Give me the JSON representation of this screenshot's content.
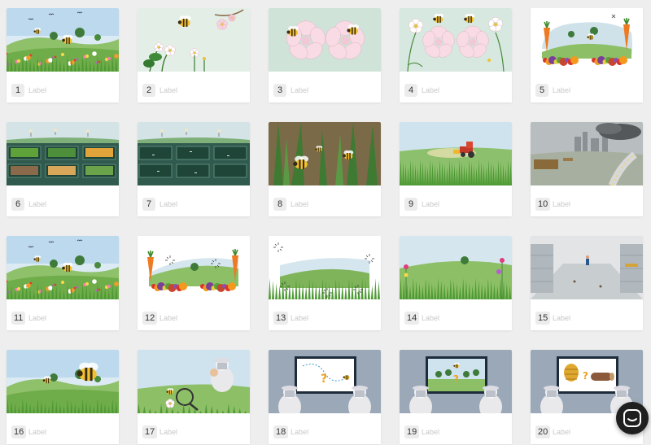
{
  "cards": [
    {
      "number": "1",
      "label": "Label",
      "scene": "meadow-flowers-bees"
    },
    {
      "number": "2",
      "label": "Label",
      "scene": "blossom-bee"
    },
    {
      "number": "3",
      "label": "Label",
      "scene": "pink-flowers-bees"
    },
    {
      "number": "4",
      "label": "Label",
      "scene": "flowers-bees-white"
    },
    {
      "number": "5",
      "label": "Label",
      "scene": "vegetables-hill"
    },
    {
      "number": "6",
      "label": "Label",
      "scene": "market-crates-full"
    },
    {
      "number": "7",
      "label": "Label",
      "scene": "market-crates-empty"
    },
    {
      "number": "8",
      "label": "Label",
      "scene": "grass-closeup-bees"
    },
    {
      "number": "9",
      "label": "Label",
      "scene": "tractor-field"
    },
    {
      "number": "10",
      "label": "Label",
      "scene": "polluted-city"
    },
    {
      "number": "11",
      "label": "Label",
      "scene": "meadow-flowers-bees"
    },
    {
      "number": "12",
      "label": "Label",
      "scene": "vegetables-hill-sparkles"
    },
    {
      "number": "13",
      "label": "Label",
      "scene": "empty-hill-sparkles"
    },
    {
      "number": "14",
      "label": "Label",
      "scene": "hill-flowers-sides"
    },
    {
      "number": "15",
      "label": "Label",
      "scene": "empty-store"
    },
    {
      "number": "16",
      "label": "Label",
      "scene": "hill-bees"
    },
    {
      "number": "17",
      "label": "Label",
      "scene": "beekeeper-magnifier"
    },
    {
      "number": "18",
      "label": "Label",
      "scene": "screen-question-path"
    },
    {
      "number": "19",
      "label": "Label",
      "scene": "screen-trees-question"
    },
    {
      "number": "20",
      "label": "Label",
      "scene": "screen-hive-log"
    }
  ],
  "chat_button": {
    "icon": "chat-icon"
  }
}
